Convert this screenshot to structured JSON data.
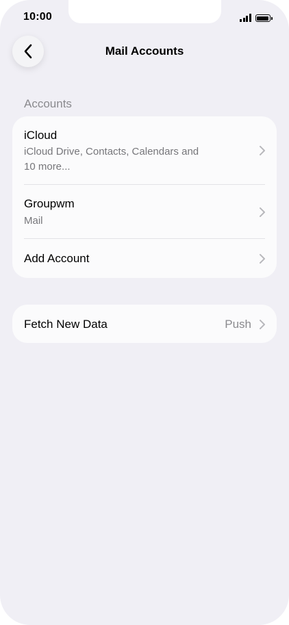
{
  "status_bar": {
    "time": "10:00",
    "icons": [
      "cellular-signal-icon",
      "battery-icon"
    ]
  },
  "nav": {
    "back_icon": "chevron-left-icon",
    "title": "Mail Accounts"
  },
  "accounts_section": {
    "header": "Accounts",
    "items": [
      {
        "title": "iCloud",
        "subtitle_line1": "iCloud Drive, Contacts, Calendars and",
        "subtitle_line2": "10 more..."
      },
      {
        "title": "Groupwm",
        "subtitle": "Mail"
      },
      {
        "title": "Add Account"
      }
    ]
  },
  "fetch_section": {
    "label": "Fetch New Data",
    "value": "Push"
  },
  "colors": {
    "background": "#f0eff5",
    "card": "#fbfbfc",
    "secondary_text": "#8a8a8e",
    "chevron": "#b8b8bc"
  }
}
